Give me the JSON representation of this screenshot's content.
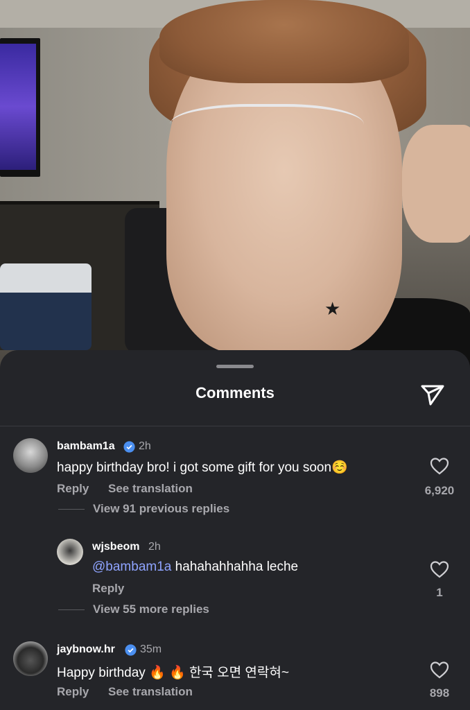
{
  "sheet": {
    "title": "Comments"
  },
  "comments": [
    {
      "username": "bambam1a",
      "verified": true,
      "time": "2h",
      "text": "happy birthday bro! i got some gift for you soon☺️",
      "reply_label": "Reply",
      "translate_label": "See translation",
      "likes": "6,920",
      "view_replies": "View 91 previous replies"
    },
    {
      "username": "wjsbeom",
      "verified": false,
      "time": "2h",
      "mention": "@bambam1a",
      "text": "hahahahhahha leche",
      "reply_label": "Reply",
      "likes": "1",
      "view_replies": "View 55 more replies"
    },
    {
      "username": "jaybnow.hr",
      "verified": true,
      "time": "35m",
      "text": "Happy birthday 🔥 🔥 한국 오면 연락혀~",
      "reply_label": "Reply",
      "translate_label": "See translation",
      "likes": "898"
    }
  ]
}
